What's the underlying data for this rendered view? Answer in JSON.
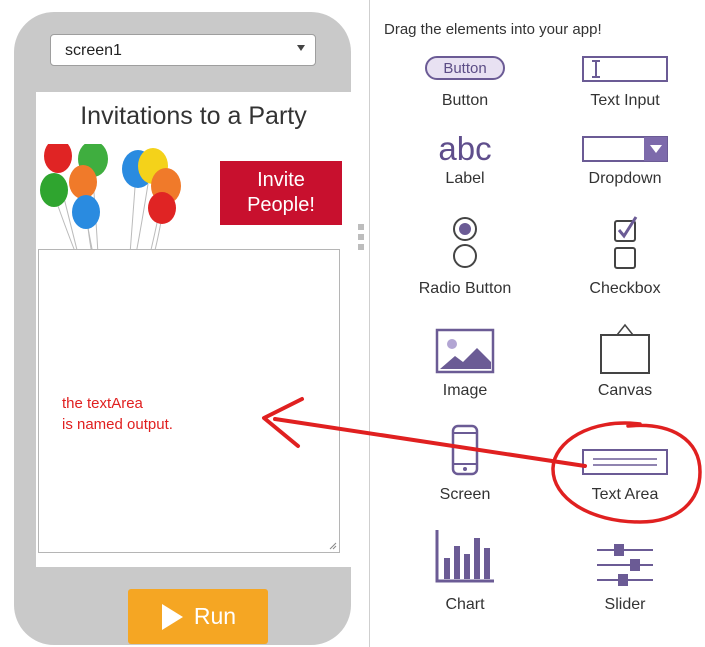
{
  "phone": {
    "screen_selector": {
      "value": "screen1"
    },
    "title": "Invitations to a Party",
    "invite_button": "Invite\nPeople!",
    "run_button": "Run"
  },
  "annotation": {
    "line1": "the textArea",
    "line2": "is named output."
  },
  "toolbox": {
    "heading": "Drag the elements into your app!",
    "items": [
      {
        "label": "Button",
        "icon": "button-icon",
        "icon_text": "Button"
      },
      {
        "label": "Text Input",
        "icon": "text-input-icon"
      },
      {
        "label": "Label",
        "icon": "label-icon",
        "icon_text": "abc"
      },
      {
        "label": "Dropdown",
        "icon": "dropdown-icon"
      },
      {
        "label": "Radio Button",
        "icon": "radio-button-icon"
      },
      {
        "label": "Checkbox",
        "icon": "checkbox-icon"
      },
      {
        "label": "Image",
        "icon": "image-icon"
      },
      {
        "label": "Canvas",
        "icon": "canvas-icon"
      },
      {
        "label": "Screen",
        "icon": "screen-icon"
      },
      {
        "label": "Text Area",
        "icon": "text-area-icon"
      },
      {
        "label": "Chart",
        "icon": "chart-icon"
      },
      {
        "label": "Slider",
        "icon": "slider-icon"
      }
    ]
  },
  "colors": {
    "icon_purple": "#6b5b95",
    "invite_red": "#c8102e",
    "run_orange": "#f5a623",
    "annotation_red": "#e02020",
    "phone_gray": "#c9c9c9"
  }
}
